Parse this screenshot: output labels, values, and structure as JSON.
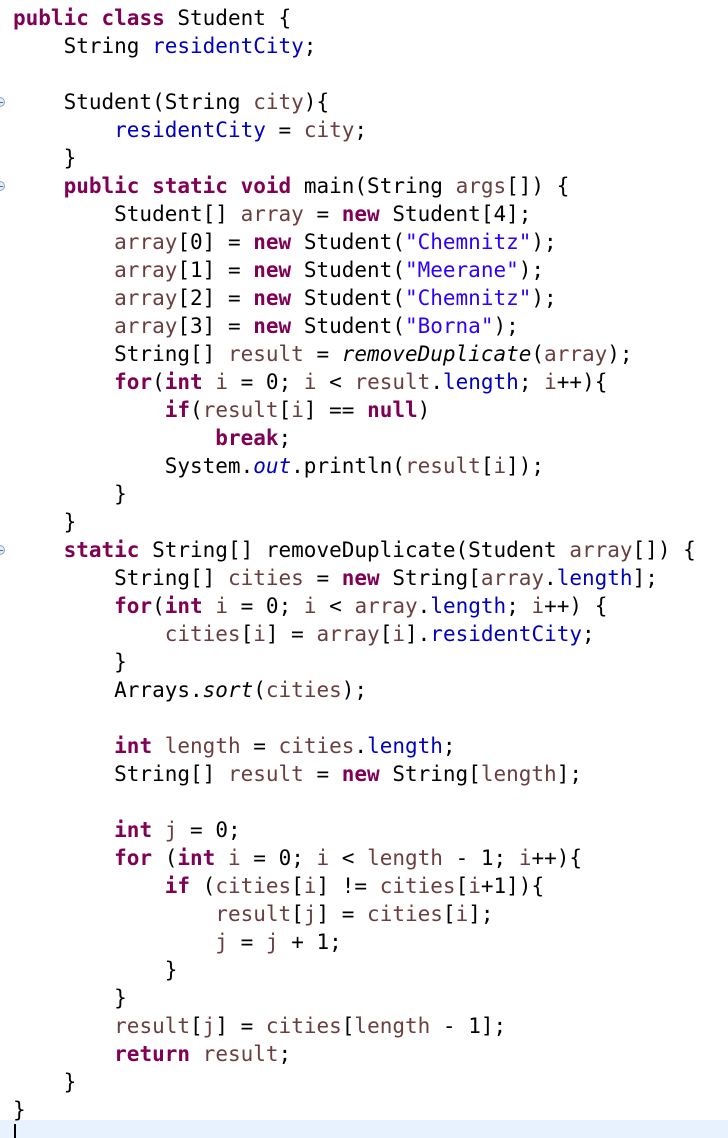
{
  "editor": {
    "language": "java",
    "theme_colors": {
      "keyword": "#7f0055",
      "field": "#0000c0",
      "string": "#2a00ff",
      "local_variable": "#6a3e3e",
      "plain": "#000000",
      "current_line": "#e8f2fe"
    },
    "fold_marker_lines": [
      4,
      7,
      20
    ],
    "lines": [
      [
        [
          "kw",
          "public"
        ],
        [
          "plain",
          " "
        ],
        [
          "kw",
          "class"
        ],
        [
          "plain",
          " Student {"
        ]
      ],
      [
        [
          "plain",
          "    String "
        ],
        [
          "field",
          "residentCity"
        ],
        [
          "plain",
          ";"
        ]
      ],
      [],
      [
        [
          "plain",
          "    Student(String "
        ],
        [
          "var",
          "city"
        ],
        [
          "plain",
          "){"
        ]
      ],
      [
        [
          "plain",
          "        "
        ],
        [
          "field",
          "residentCity"
        ],
        [
          "plain",
          " = "
        ],
        [
          "var",
          "city"
        ],
        [
          "plain",
          ";"
        ]
      ],
      [
        [
          "plain",
          "    }"
        ]
      ],
      [
        [
          "plain",
          "    "
        ],
        [
          "kw",
          "public"
        ],
        [
          "plain",
          " "
        ],
        [
          "kw",
          "static"
        ],
        [
          "plain",
          " "
        ],
        [
          "kw",
          "void"
        ],
        [
          "plain",
          " main(String "
        ],
        [
          "var",
          "args"
        ],
        [
          "plain",
          "[]) {"
        ]
      ],
      [
        [
          "plain",
          "        Student[] "
        ],
        [
          "var",
          "array"
        ],
        [
          "plain",
          " = "
        ],
        [
          "kw",
          "new"
        ],
        [
          "plain",
          " Student[4];"
        ]
      ],
      [
        [
          "plain",
          "        "
        ],
        [
          "var",
          "array"
        ],
        [
          "plain",
          "[0] = "
        ],
        [
          "kw",
          "new"
        ],
        [
          "plain",
          " Student("
        ],
        [
          "string",
          "\"Chemnitz\""
        ],
        [
          "plain",
          ");"
        ]
      ],
      [
        [
          "plain",
          "        "
        ],
        [
          "var",
          "array"
        ],
        [
          "plain",
          "[1] = "
        ],
        [
          "kw",
          "new"
        ],
        [
          "plain",
          " Student("
        ],
        [
          "string",
          "\"Meerane\""
        ],
        [
          "plain",
          ");"
        ]
      ],
      [
        [
          "plain",
          "        "
        ],
        [
          "var",
          "array"
        ],
        [
          "plain",
          "[2] = "
        ],
        [
          "kw",
          "new"
        ],
        [
          "plain",
          " Student("
        ],
        [
          "string",
          "\"Chemnitz\""
        ],
        [
          "plain",
          ");"
        ]
      ],
      [
        [
          "plain",
          "        "
        ],
        [
          "var",
          "array"
        ],
        [
          "plain",
          "[3] = "
        ],
        [
          "kw",
          "new"
        ],
        [
          "plain",
          " Student("
        ],
        [
          "string",
          "\"Borna\""
        ],
        [
          "plain",
          ");"
        ]
      ],
      [
        [
          "plain",
          "        String[] "
        ],
        [
          "var",
          "result"
        ],
        [
          "plain",
          " = "
        ],
        [
          "method",
          "removeDuplicate"
        ],
        [
          "plain",
          "("
        ],
        [
          "var",
          "array"
        ],
        [
          "plain",
          ");"
        ]
      ],
      [
        [
          "plain",
          "        "
        ],
        [
          "kw",
          "for"
        ],
        [
          "plain",
          "("
        ],
        [
          "kw",
          "int"
        ],
        [
          "plain",
          " "
        ],
        [
          "var",
          "i"
        ],
        [
          "plain",
          " = 0; "
        ],
        [
          "var",
          "i"
        ],
        [
          "plain",
          " < "
        ],
        [
          "var",
          "result"
        ],
        [
          "plain",
          "."
        ],
        [
          "field",
          "length"
        ],
        [
          "plain",
          "; "
        ],
        [
          "var",
          "i"
        ],
        [
          "plain",
          "++){"
        ]
      ],
      [
        [
          "plain",
          "            "
        ],
        [
          "kw",
          "if"
        ],
        [
          "plain",
          "("
        ],
        [
          "var",
          "result"
        ],
        [
          "plain",
          "["
        ],
        [
          "var",
          "i"
        ],
        [
          "plain",
          "] == "
        ],
        [
          "kw",
          "null"
        ],
        [
          "plain",
          ")"
        ]
      ],
      [
        [
          "plain",
          "                "
        ],
        [
          "kw",
          "break"
        ],
        [
          "plain",
          ";"
        ]
      ],
      [
        [
          "plain",
          "            System."
        ],
        [
          "staticfield",
          "out"
        ],
        [
          "plain",
          ".println("
        ],
        [
          "var",
          "result"
        ],
        [
          "plain",
          "["
        ],
        [
          "var",
          "i"
        ],
        [
          "plain",
          "]);"
        ]
      ],
      [
        [
          "plain",
          "        }"
        ]
      ],
      [
        [
          "plain",
          "    }"
        ]
      ],
      [
        [
          "plain",
          "    "
        ],
        [
          "kw",
          "static"
        ],
        [
          "plain",
          " String[] removeDuplicate(Student "
        ],
        [
          "var",
          "array"
        ],
        [
          "plain",
          "[]) {"
        ]
      ],
      [
        [
          "plain",
          "        String[] "
        ],
        [
          "var",
          "cities"
        ],
        [
          "plain",
          " = "
        ],
        [
          "kw",
          "new"
        ],
        [
          "plain",
          " String["
        ],
        [
          "var",
          "array"
        ],
        [
          "plain",
          "."
        ],
        [
          "field",
          "length"
        ],
        [
          "plain",
          "];"
        ]
      ],
      [
        [
          "plain",
          "        "
        ],
        [
          "kw",
          "for"
        ],
        [
          "plain",
          "("
        ],
        [
          "kw",
          "int"
        ],
        [
          "plain",
          " "
        ],
        [
          "var",
          "i"
        ],
        [
          "plain",
          " = 0; "
        ],
        [
          "var",
          "i"
        ],
        [
          "plain",
          " < "
        ],
        [
          "var",
          "array"
        ],
        [
          "plain",
          "."
        ],
        [
          "field",
          "length"
        ],
        [
          "plain",
          "; "
        ],
        [
          "var",
          "i"
        ],
        [
          "plain",
          "++) {"
        ]
      ],
      [
        [
          "plain",
          "            "
        ],
        [
          "var",
          "cities"
        ],
        [
          "plain",
          "["
        ],
        [
          "var",
          "i"
        ],
        [
          "plain",
          "] = "
        ],
        [
          "var",
          "array"
        ],
        [
          "plain",
          "["
        ],
        [
          "var",
          "i"
        ],
        [
          "plain",
          "]."
        ],
        [
          "field",
          "residentCity"
        ],
        [
          "plain",
          ";"
        ]
      ],
      [
        [
          "plain",
          "        }"
        ]
      ],
      [
        [
          "plain",
          "        Arrays."
        ],
        [
          "method",
          "sort"
        ],
        [
          "plain",
          "("
        ],
        [
          "var",
          "cities"
        ],
        [
          "plain",
          ");"
        ]
      ],
      [],
      [
        [
          "plain",
          "        "
        ],
        [
          "kw",
          "int"
        ],
        [
          "plain",
          " "
        ],
        [
          "var",
          "length"
        ],
        [
          "plain",
          " = "
        ],
        [
          "var",
          "cities"
        ],
        [
          "plain",
          "."
        ],
        [
          "field",
          "length"
        ],
        [
          "plain",
          ";"
        ]
      ],
      [
        [
          "plain",
          "        String[] "
        ],
        [
          "var",
          "result"
        ],
        [
          "plain",
          " = "
        ],
        [
          "kw",
          "new"
        ],
        [
          "plain",
          " String["
        ],
        [
          "var",
          "length"
        ],
        [
          "plain",
          "];"
        ]
      ],
      [],
      [
        [
          "plain",
          "        "
        ],
        [
          "kw",
          "int"
        ],
        [
          "plain",
          " "
        ],
        [
          "var",
          "j"
        ],
        [
          "plain",
          " = 0;"
        ]
      ],
      [
        [
          "plain",
          "        "
        ],
        [
          "kw",
          "for"
        ],
        [
          "plain",
          " ("
        ],
        [
          "kw",
          "int"
        ],
        [
          "plain",
          " "
        ],
        [
          "var",
          "i"
        ],
        [
          "plain",
          " = 0; "
        ],
        [
          "var",
          "i"
        ],
        [
          "plain",
          " < "
        ],
        [
          "var",
          "length"
        ],
        [
          "plain",
          " - 1; "
        ],
        [
          "var",
          "i"
        ],
        [
          "plain",
          "++){"
        ]
      ],
      [
        [
          "plain",
          "            "
        ],
        [
          "kw",
          "if"
        ],
        [
          "plain",
          " ("
        ],
        [
          "var",
          "cities"
        ],
        [
          "plain",
          "["
        ],
        [
          "var",
          "i"
        ],
        [
          "plain",
          "] != "
        ],
        [
          "var",
          "cities"
        ],
        [
          "plain",
          "["
        ],
        [
          "var",
          "i"
        ],
        [
          "plain",
          "+1]){"
        ]
      ],
      [
        [
          "plain",
          "                "
        ],
        [
          "var",
          "result"
        ],
        [
          "plain",
          "["
        ],
        [
          "var",
          "j"
        ],
        [
          "plain",
          "] = "
        ],
        [
          "var",
          "cities"
        ],
        [
          "plain",
          "["
        ],
        [
          "var",
          "i"
        ],
        [
          "plain",
          "];"
        ]
      ],
      [
        [
          "plain",
          "                "
        ],
        [
          "var",
          "j"
        ],
        [
          "plain",
          " = "
        ],
        [
          "var",
          "j"
        ],
        [
          "plain",
          " + 1;"
        ]
      ],
      [
        [
          "plain",
          "            }"
        ]
      ],
      [
        [
          "plain",
          "        }"
        ]
      ],
      [
        [
          "plain",
          "        "
        ],
        [
          "var",
          "result"
        ],
        [
          "plain",
          "["
        ],
        [
          "var",
          "j"
        ],
        [
          "plain",
          "] = "
        ],
        [
          "var",
          "cities"
        ],
        [
          "plain",
          "["
        ],
        [
          "var",
          "length"
        ],
        [
          "plain",
          " - 1];"
        ]
      ],
      [
        [
          "plain",
          "        "
        ],
        [
          "kw",
          "return"
        ],
        [
          "plain",
          " "
        ],
        [
          "var",
          "result"
        ],
        [
          "plain",
          ";"
        ]
      ],
      [
        [
          "plain",
          "    }"
        ]
      ],
      [
        [
          "plain",
          "}"
        ]
      ]
    ]
  }
}
